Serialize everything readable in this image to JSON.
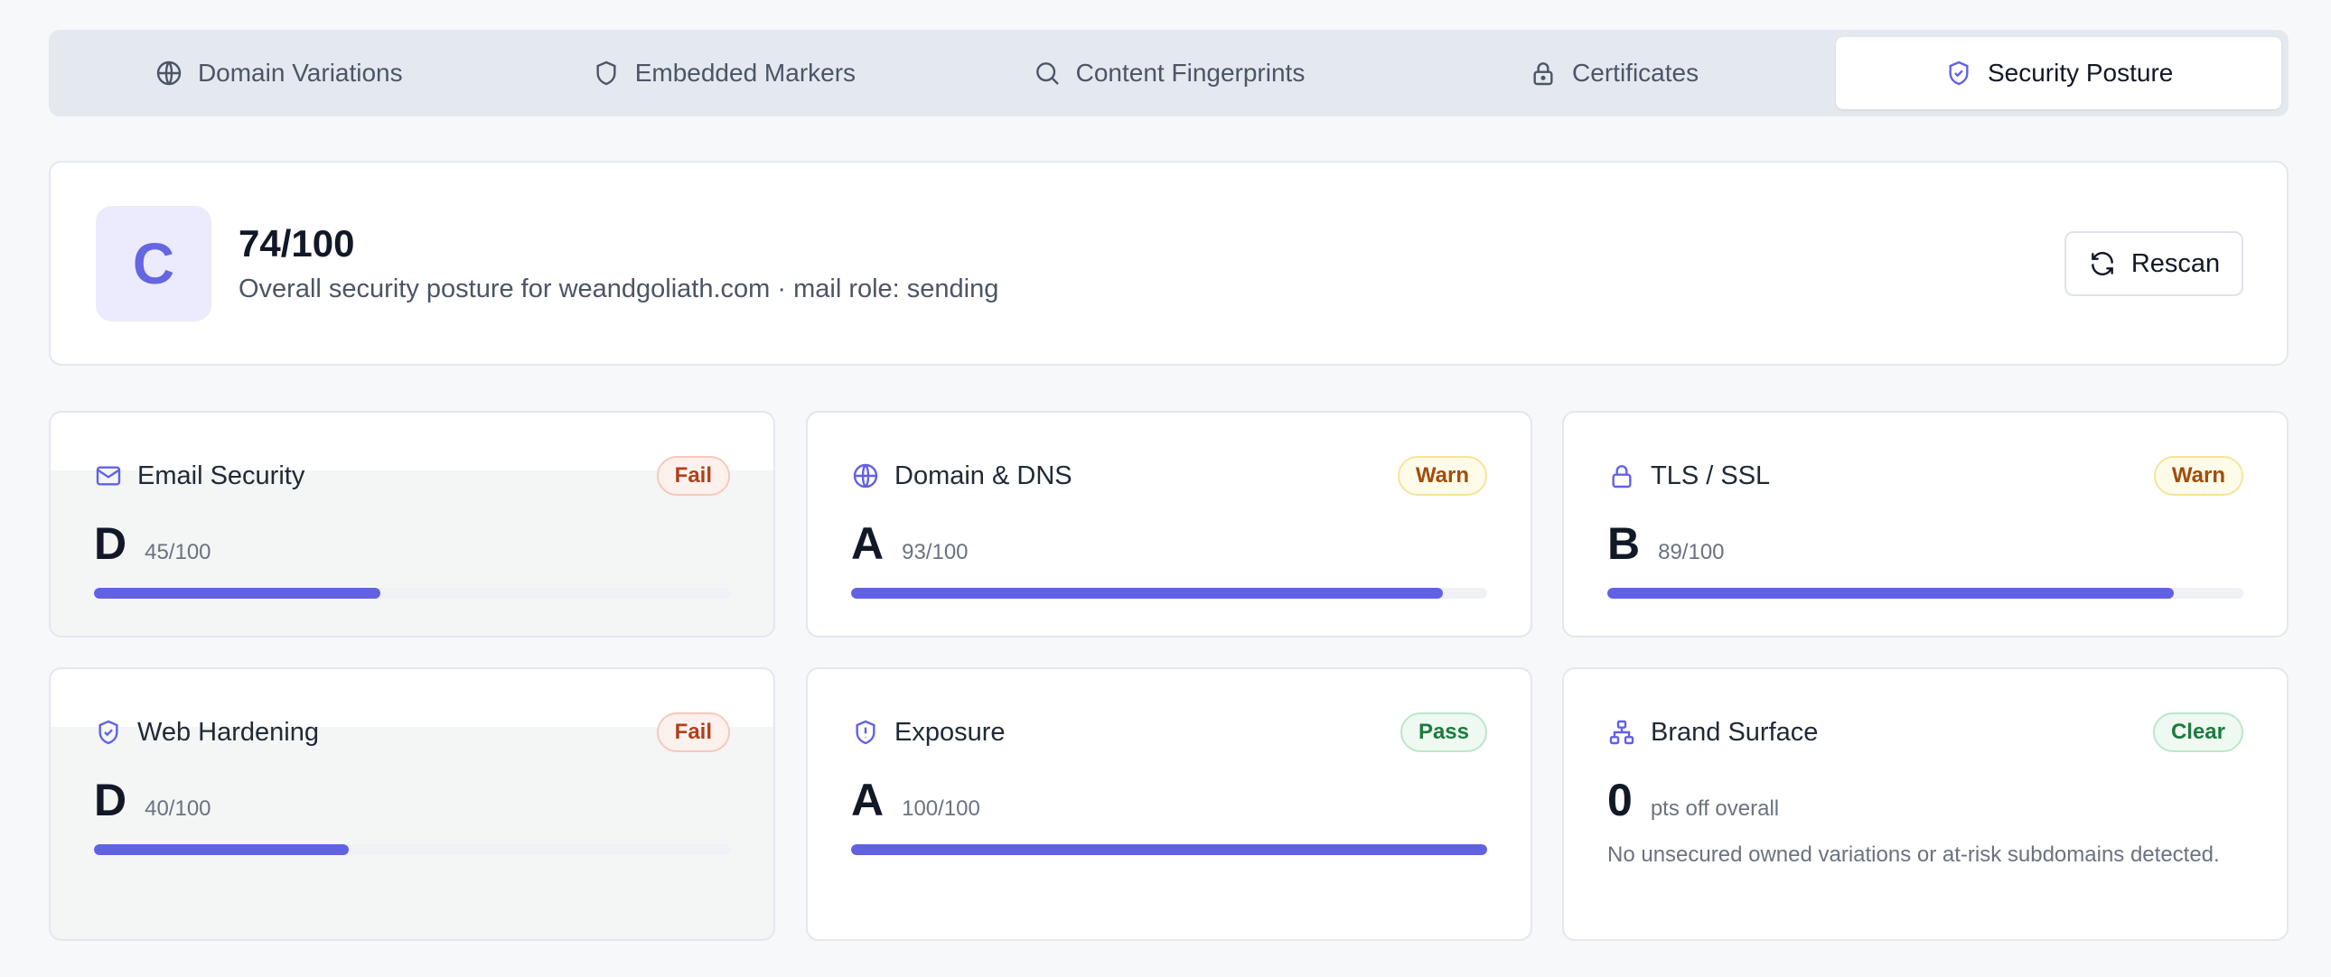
{
  "tabs": [
    {
      "label": "Domain Variations",
      "icon": "globe-icon",
      "active": false
    },
    {
      "label": "Embedded Markers",
      "icon": "shield-icon",
      "active": false
    },
    {
      "label": "Content Fingerprints",
      "icon": "search-icon",
      "active": false
    },
    {
      "label": "Certificates",
      "icon": "lock-icon",
      "active": false
    },
    {
      "label": "Security Posture",
      "icon": "shield-check-icon",
      "active": true
    }
  ],
  "summary": {
    "grade": "C",
    "score": "74/100",
    "description": "Overall security posture for weandgoliath.com · mail role: sending",
    "rescan_label": "Rescan"
  },
  "categories": [
    {
      "title": "Email Security",
      "icon": "mail-icon",
      "status": "Fail",
      "grade": "D",
      "score": "45/100",
      "progress": 0.45
    },
    {
      "title": "Domain & DNS",
      "icon": "globe-icon",
      "status": "Warn",
      "grade": "A",
      "score": "93/100",
      "progress": 0.93
    },
    {
      "title": "TLS / SSL",
      "icon": "lock-icon",
      "status": "Warn",
      "grade": "B",
      "score": "89/100",
      "progress": 0.89
    },
    {
      "title": "Web Hardening",
      "icon": "shield-check-icon",
      "status": "Fail",
      "grade": "D",
      "score": "40/100",
      "progress": 0.4
    },
    {
      "title": "Exposure",
      "icon": "shield-alert-icon",
      "status": "Pass",
      "grade": "A",
      "score": "100/100",
      "progress": 1.0
    },
    {
      "title": "Brand Surface",
      "icon": "network-icon",
      "status": "Clear",
      "grade": "0",
      "score": "pts off overall",
      "note": "No unsecured owned variations or at-risk subdomains detected."
    }
  ],
  "colors": {
    "accent": "#6161e4",
    "fail": "#b0401c",
    "warn": "#a14d0c",
    "pass": "#1f7a3e"
  }
}
